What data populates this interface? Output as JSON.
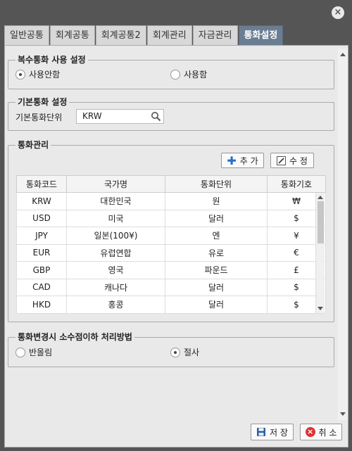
{
  "window": {
    "close_icon": "×"
  },
  "tabs": [
    {
      "label": "일반공통"
    },
    {
      "label": "회계공통"
    },
    {
      "label": "회계공통2"
    },
    {
      "label": "회계관리"
    },
    {
      "label": "자금관리"
    },
    {
      "label": "통화설정",
      "active": true
    }
  ],
  "multi_currency": {
    "legend": "복수통화 사용 설정",
    "options": [
      "사용안함",
      "사용함"
    ],
    "selected": "사용안함"
  },
  "base_currency": {
    "legend": "기본통화 설정",
    "label": "기본통화단위",
    "value": "KRW"
  },
  "currency_mgmt": {
    "legend": "통화관리",
    "add_label": "추 가",
    "edit_label": "수 정",
    "columns": [
      "통화코드",
      "국가명",
      "통화단위",
      "통화기호"
    ],
    "rows": [
      [
        "KRW",
        "대한민국",
        "원",
        "₩"
      ],
      [
        "USD",
        "미국",
        "달러",
        "$"
      ],
      [
        "JPY",
        "일본(100¥)",
        "엔",
        "¥"
      ],
      [
        "EUR",
        "유럽연합",
        "유로",
        "€"
      ],
      [
        "GBP",
        "영국",
        "파운드",
        "£"
      ],
      [
        "CAD",
        "캐나다",
        "달러",
        "$"
      ],
      [
        "HKD",
        "홍콩",
        "달러",
        "$"
      ]
    ]
  },
  "rounding": {
    "legend": "통화변경시 소수점이하 처리방법",
    "options": [
      "반올림",
      "절사"
    ],
    "selected": "절사"
  },
  "footer": {
    "save_label": "저 장",
    "cancel_label": "취 소"
  },
  "colors": {
    "active_tab": "#6b7d92",
    "add_icon": "#2a6fc9",
    "cancel_icon": "#d33"
  }
}
